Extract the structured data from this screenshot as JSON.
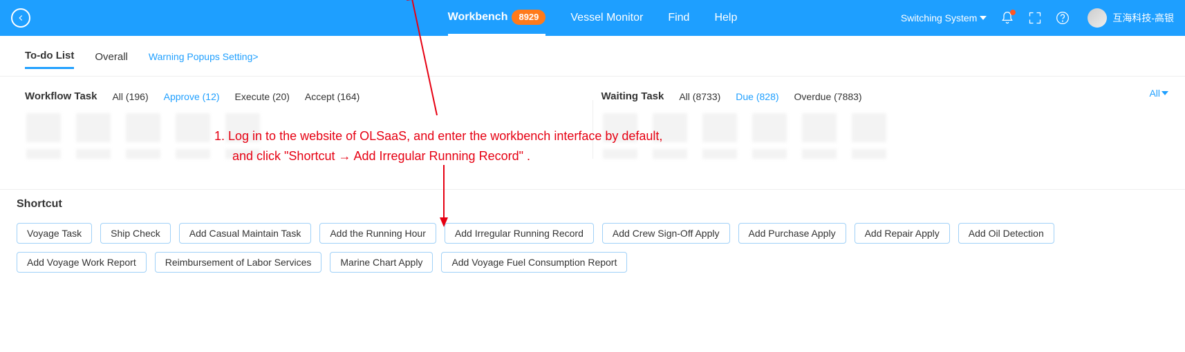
{
  "topnav": {
    "items": [
      {
        "label": "Workbench",
        "badge": "8929",
        "active": true
      },
      {
        "label": "Vessel Monitor"
      },
      {
        "label": "Find"
      },
      {
        "label": "Help"
      }
    ]
  },
  "topright": {
    "switch_label": "Switching System",
    "user_name": "互海科技-高银"
  },
  "tabs": {
    "todo": "To-do List",
    "overall": "Overall",
    "warning": "Warning Popups Setting>"
  },
  "allfilter_label": "All",
  "workflow": {
    "title": "Workflow Task",
    "filters": [
      {
        "label": "All (196)"
      },
      {
        "label": "Approve (12)",
        "link": true
      },
      {
        "label": "Execute (20)"
      },
      {
        "label": "Accept (164)"
      }
    ]
  },
  "waiting": {
    "title": "Waiting Task",
    "filters": [
      {
        "label": "All (8733)"
      },
      {
        "label": "Due (828)",
        "link": true
      },
      {
        "label": "Overdue (7883)"
      }
    ]
  },
  "annotation_line1": "1. Log in to the website of OLSaaS, and enter the workbench interface by default,",
  "annotation_line2": "and click \"Shortcut → Add Irregular Running Record\" .",
  "shortcut": {
    "title": "Shortcut",
    "items": [
      "Voyage Task",
      "Ship Check",
      "Add Casual Maintain Task",
      "Add the Running Hour",
      "Add Irregular Running Record",
      "Add Crew Sign-Off Apply",
      "Add Purchase Apply",
      "Add Repair Apply",
      "Add Oil Detection",
      "Add Voyage Work Report",
      "Reimbursement of Labor Services",
      "Marine Chart Apply",
      "Add Voyage Fuel Consumption Report"
    ]
  }
}
